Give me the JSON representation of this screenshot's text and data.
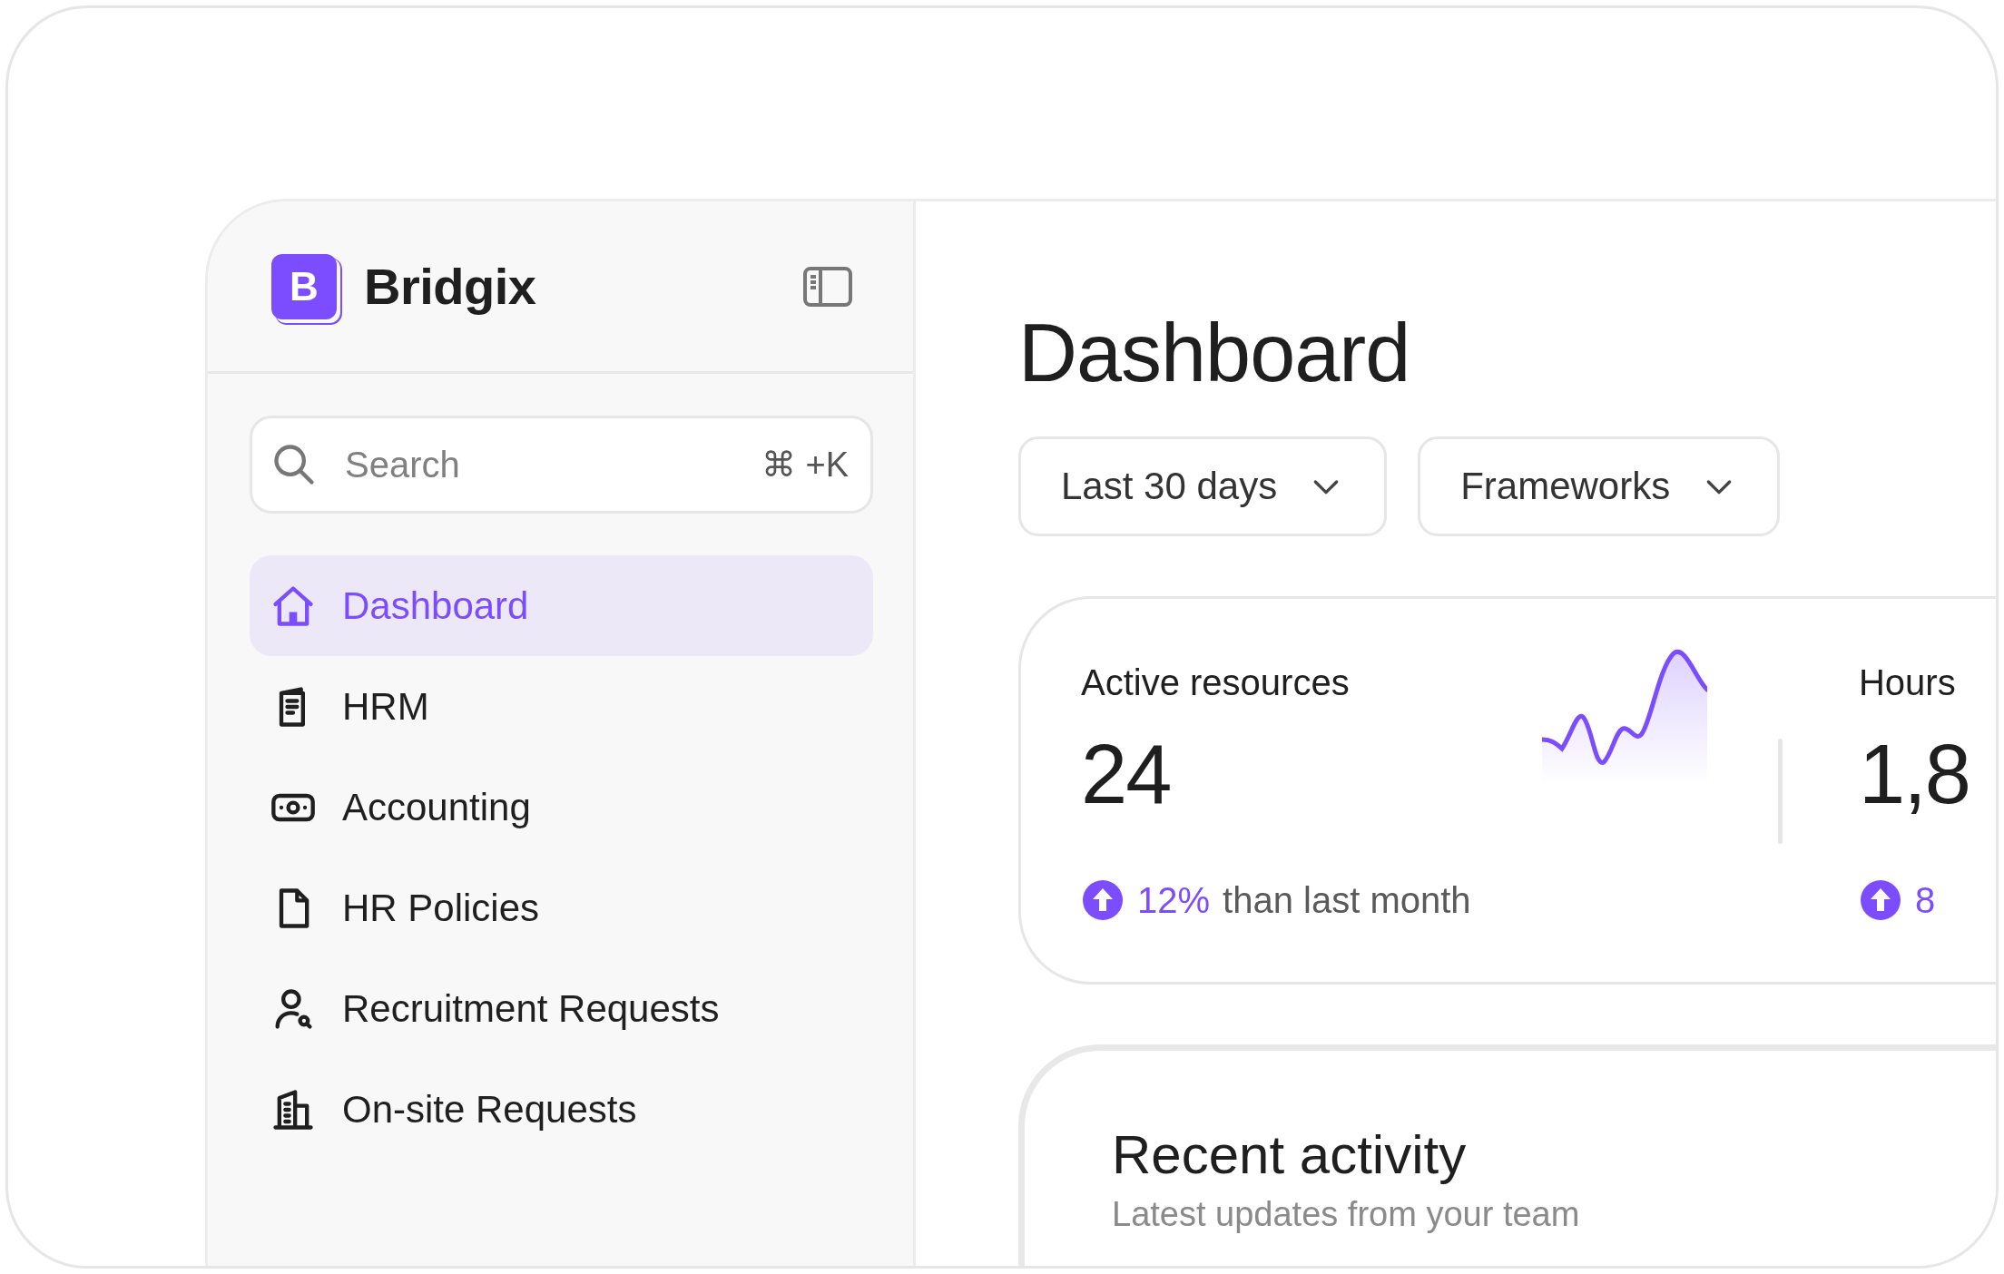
{
  "brand": {
    "name": "Bridgix",
    "logo_letter": "B"
  },
  "search": {
    "placeholder": "Search",
    "shortcut": "⌘ +K"
  },
  "nav": [
    {
      "label": "Dashboard",
      "selected": true
    },
    {
      "label": "HRM",
      "selected": false
    },
    {
      "label": "Accounting",
      "selected": false
    },
    {
      "label": "HR Policies",
      "selected": false
    },
    {
      "label": "Recruitment Requests",
      "selected": false
    },
    {
      "label": "On-site Requests",
      "selected": false
    }
  ],
  "page_title": "Dashboard",
  "filters": [
    {
      "label": "Last 30 days"
    },
    {
      "label": "Frameworks"
    }
  ],
  "stats": [
    {
      "label": "Active resources",
      "value": "24",
      "change": "12%",
      "change_note": "than last month",
      "kind": "sparkline"
    },
    {
      "label": "Hours",
      "value": "1,8",
      "change": "8",
      "kind": "plain"
    }
  ],
  "recent_activity": {
    "title": "Recent activity",
    "subtitle": "Latest updates from your team"
  }
}
